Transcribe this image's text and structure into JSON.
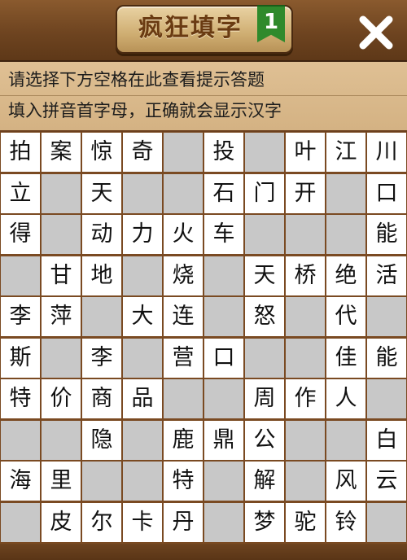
{
  "header": {
    "title": "疯狂填字",
    "level": "1",
    "close_icon": "close-icon"
  },
  "hints": {
    "line1": "请选择下方空格在此查看提示答题",
    "line2": "填入拼音首字母，正确就会显示汉字"
  },
  "colors": {
    "wood": "#6b3f1e",
    "panel": "#d9b98a",
    "cell_white": "#ffffff",
    "cell_gray": "#c8c8c8",
    "badge": "#2f8a2c"
  },
  "grid": {
    "rows": [
      [
        "拍",
        "案",
        "惊",
        "奇",
        null,
        "投",
        null,
        "叶",
        "江",
        "川"
      ],
      [
        "立",
        "",
        "天",
        "",
        "",
        "石",
        "门",
        "开",
        null,
        "口"
      ],
      [
        "得",
        "",
        "动",
        "力",
        "火",
        "车",
        "",
        "",
        "",
        "能"
      ],
      [
        "",
        "甘",
        "地",
        "",
        "烧",
        "",
        "天",
        "桥",
        "绝",
        "活"
      ],
      [
        "李",
        "萍",
        "",
        "大",
        "连",
        "",
        "怒",
        "",
        "代",
        ""
      ],
      [
        "斯",
        "",
        "李",
        "",
        "营",
        "口",
        "",
        "",
        "佳",
        "能"
      ],
      [
        "特",
        "价",
        "商",
        "品",
        "",
        "",
        "周",
        "作",
        "人",
        ""
      ],
      [
        "",
        "",
        "隐",
        "",
        "鹿",
        "鼎",
        "公",
        "",
        "",
        "白"
      ],
      [
        "海",
        "里",
        "",
        "",
        "特",
        "",
        "解",
        "",
        "风",
        "云"
      ],
      [
        "",
        "皮",
        "尔",
        "卡",
        "丹",
        "",
        "梦",
        "驼",
        "铃",
        ""
      ]
    ],
    "open": [
      [
        1,
        1,
        1,
        1,
        0,
        1,
        0,
        1,
        1,
        1
      ],
      [
        1,
        0,
        1,
        0,
        0,
        1,
        1,
        1,
        0,
        1
      ],
      [
        1,
        0,
        1,
        1,
        1,
        1,
        0,
        0,
        0,
        1
      ],
      [
        0,
        1,
        1,
        0,
        1,
        0,
        1,
        1,
        1,
        1
      ],
      [
        1,
        1,
        0,
        1,
        1,
        0,
        1,
        0,
        1,
        0
      ],
      [
        1,
        0,
        1,
        0,
        1,
        1,
        0,
        0,
        1,
        1
      ],
      [
        1,
        1,
        1,
        1,
        0,
        0,
        1,
        1,
        1,
        0
      ],
      [
        0,
        0,
        1,
        0,
        1,
        1,
        1,
        0,
        0,
        1
      ],
      [
        1,
        1,
        0,
        0,
        1,
        0,
        1,
        0,
        1,
        1
      ],
      [
        0,
        1,
        1,
        1,
        1,
        0,
        1,
        1,
        1,
        0
      ]
    ]
  }
}
